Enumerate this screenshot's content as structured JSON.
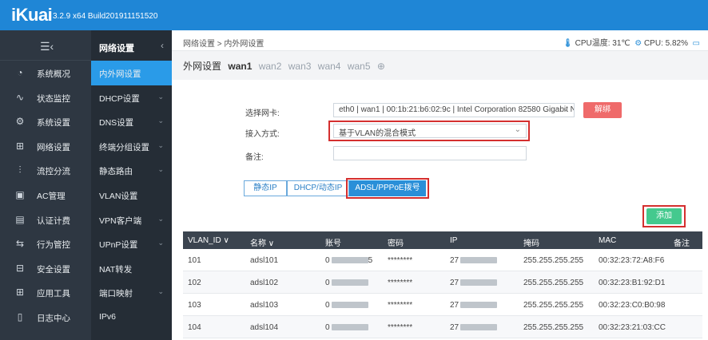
{
  "brand": {
    "logo": "iKuai",
    "version": "3.2.9 x64 Build201911151520"
  },
  "nav_primary": {
    "burger": "☰‹",
    "items": [
      {
        "label": "系统概况",
        "icon": "gauge-icon",
        "glyph": "◔"
      },
      {
        "label": "状态监控",
        "icon": "pulse-icon",
        "glyph": "∿"
      },
      {
        "label": "系统设置",
        "icon": "gear-icon",
        "glyph": "⚙"
      },
      {
        "label": "网络设置",
        "icon": "network-icon",
        "glyph": "⊞"
      },
      {
        "label": "流控分流",
        "icon": "sliders-icon",
        "glyph": "⫶"
      },
      {
        "label": "AC管理",
        "icon": "monitor-icon",
        "glyph": "▣"
      },
      {
        "label": "认证计费",
        "icon": "id-card-icon",
        "glyph": "▤"
      },
      {
        "label": "行为管控",
        "icon": "arrows-icon",
        "glyph": "⇆"
      },
      {
        "label": "安全设置",
        "icon": "shield-icon",
        "glyph": "⊟"
      },
      {
        "label": "应用工具",
        "icon": "apps-icon",
        "glyph": "⊞"
      },
      {
        "label": "日志中心",
        "icon": "log-icon",
        "glyph": "▯"
      }
    ]
  },
  "nav_secondary": {
    "title": "网络设置",
    "collapse": "‹",
    "items": [
      {
        "label": "内外网设置",
        "chev": ""
      },
      {
        "label": "DHCP设置",
        "chev": "⌄"
      },
      {
        "label": "DNS设置",
        "chev": "⌄"
      },
      {
        "label": "终端分组设置",
        "chev": "⌄"
      },
      {
        "label": "静态路由",
        "chev": "⌄"
      },
      {
        "label": "VLAN设置",
        "chev": ""
      },
      {
        "label": "VPN客户端",
        "chev": "⌄"
      },
      {
        "label": "UPnP设置",
        "chev": "⌄"
      },
      {
        "label": "NAT转发",
        "chev": ""
      },
      {
        "label": "端口映射",
        "chev": "⌄"
      },
      {
        "label": "IPv6",
        "chev": ""
      }
    ]
  },
  "header": {
    "breadcrumb": "网络设置 > 内外网设置",
    "temp_icon": "🌡",
    "temp_label": "CPU温度: 31℃",
    "cpu_icon": "⚙",
    "cpu_label": "CPU: 5.82%",
    "screen_icon": "▭"
  },
  "tabs": {
    "prefix": "外网设置",
    "selected": "wan1",
    "others": [
      "wan2",
      "wan3",
      "wan4",
      "wan5"
    ],
    "add": "⊕"
  },
  "form": {
    "nic_label": "选择网卡:",
    "nic_value": "eth0 | wan1 | 00:1b:21:b6:02:9c | Intel Corporation 82580 Gigabit Netw",
    "unbind_label": "解绑",
    "mode_label": "接入方式:",
    "mode_value": "基于VLAN的混合模式",
    "note_label": "备注:",
    "note_value": ""
  },
  "segments": [
    "静态IP",
    "DHCP/动态IP",
    "ADSL/PPPoE拨号"
  ],
  "add_label": "添加",
  "table": {
    "headers": [
      "VLAN_ID ∨",
      "名称 ∨",
      "账号",
      "密码",
      "IP",
      "掩码",
      "MAC",
      "备注"
    ],
    "rows": [
      {
        "vlan": "101",
        "name": "adsl101",
        "acct": "0",
        "acct_tail": "5",
        "pwd": "********",
        "ip": "27",
        "ip_tail": "",
        "mask": "255.255.255.255",
        "mac": "00:32:23:72:A8:F6"
      },
      {
        "vlan": "102",
        "name": "adsl102",
        "acct": "0",
        "acct_tail": "",
        "pwd": "********",
        "ip": "27",
        "ip_tail": "",
        "mask": "255.255.255.255",
        "mac": "00:32:23:B1:92:D1"
      },
      {
        "vlan": "103",
        "name": "adsl103",
        "acct": "0",
        "acct_tail": "",
        "pwd": "********",
        "ip": "27",
        "ip_tail": "",
        "mask": "255.255.255.255",
        "mac": "00:32:23:C0:B0:98"
      },
      {
        "vlan": "104",
        "name": "adsl104",
        "acct": "0",
        "acct_tail": "",
        "pwd": "********",
        "ip": "27",
        "ip_tail": "",
        "mask": "255.255.255.255",
        "mac": "00:32:23:21:03:CC"
      }
    ]
  }
}
